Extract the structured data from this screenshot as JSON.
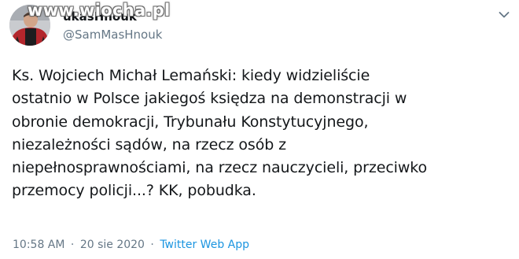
{
  "watermark": "www.wiocha.pl",
  "author": {
    "display_name": "ukasHnouk",
    "handle": "@SamMasHnouk"
  },
  "tweet": {
    "lines": [
      "Ks. Wojciech Michał Lemański: kiedy widzieliście",
      "ostatnio w Polsce jakiegoś księdza na demonstracji w",
      "obronie demokracji, Trybunału Konstytucyjnego,",
      "niezależności sądów, na rzecz osób z",
      "niepełnosprawnościami, na rzecz nauczycieli, przeciwko",
      "przemocy policji...? KK, pobudka."
    ]
  },
  "meta": {
    "time": "10:58 AM",
    "separator": "·",
    "date": "20 sie 2020",
    "source": "Twitter Web App"
  },
  "icons": {
    "menu": "chevron-down-icon",
    "avatar": "profile-photo"
  },
  "colors": {
    "text": "#14171a",
    "muted": "#657786",
    "link": "#1b95e0"
  }
}
